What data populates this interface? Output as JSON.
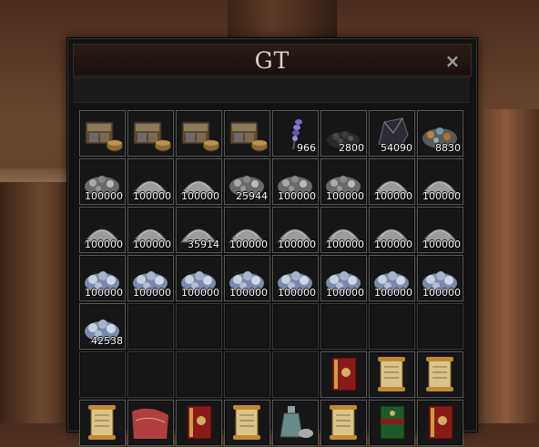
{
  "window": {
    "title": "GT",
    "close_glyph": "×"
  },
  "colors": {
    "chest": "#8a7a58",
    "ore_gray": "#9c9c9c",
    "ore_blue": "#7a8aa8",
    "scroll": "#d9c48a",
    "book_red": "#8a1a18",
    "coal": "#2a2a2a",
    "green_book": "#1f5a2a"
  },
  "inventory": [
    {
      "icon": "treasure-chest-icon",
      "qty": ""
    },
    {
      "icon": "treasure-chest-icon",
      "qty": ""
    },
    {
      "icon": "treasure-chest-icon",
      "qty": ""
    },
    {
      "icon": "treasure-chest-icon",
      "qty": ""
    },
    {
      "icon": "lavender-herb-icon",
      "qty": "966"
    },
    {
      "icon": "black-stone-pile-icon",
      "qty": "2800"
    },
    {
      "icon": "black-crystal-icon",
      "qty": "54090"
    },
    {
      "icon": "ore-mixed-pile-icon",
      "qty": "8830"
    },
    {
      "icon": "ore-pile-icon",
      "qty": "100000"
    },
    {
      "icon": "stone-pile-icon",
      "qty": "100000"
    },
    {
      "icon": "stone-pile-icon",
      "qty": "100000"
    },
    {
      "icon": "ore-pile-icon",
      "qty": "25944"
    },
    {
      "icon": "ore-pile-icon",
      "qty": "100000"
    },
    {
      "icon": "ore-pile-icon",
      "qty": "100000"
    },
    {
      "icon": "stone-pile-icon",
      "qty": "100000"
    },
    {
      "icon": "stone-pile-icon",
      "qty": "100000"
    },
    {
      "icon": "stone-pile-icon",
      "qty": "100000"
    },
    {
      "icon": "stone-pile-icon",
      "qty": "100000"
    },
    {
      "icon": "stone-pile-icon",
      "qty": "35914"
    },
    {
      "icon": "stone-pile-icon",
      "qty": "100000"
    },
    {
      "icon": "stone-pile-icon",
      "qty": "100000"
    },
    {
      "icon": "stone-pile-icon",
      "qty": "100000"
    },
    {
      "icon": "stone-pile-icon",
      "qty": "100000"
    },
    {
      "icon": "stone-pile-icon",
      "qty": "100000"
    },
    {
      "icon": "silver-ore-icon",
      "qty": "100000"
    },
    {
      "icon": "silver-ore-icon",
      "qty": "100000"
    },
    {
      "icon": "silver-ore-icon",
      "qty": "100000"
    },
    {
      "icon": "silver-ore-icon",
      "qty": "100000"
    },
    {
      "icon": "silver-ore-icon",
      "qty": "100000"
    },
    {
      "icon": "silver-ore-icon",
      "qty": "100000"
    },
    {
      "icon": "silver-ore-icon",
      "qty": "100000"
    },
    {
      "icon": "silver-ore-icon",
      "qty": "100000"
    },
    {
      "icon": "silver-ore-icon",
      "qty": "42538"
    },
    {
      "icon": "",
      "qty": ""
    },
    {
      "icon": "",
      "qty": ""
    },
    {
      "icon": "",
      "qty": ""
    },
    {
      "icon": "",
      "qty": ""
    },
    {
      "icon": "",
      "qty": ""
    },
    {
      "icon": "",
      "qty": ""
    },
    {
      "icon": "",
      "qty": ""
    },
    {
      "icon": "",
      "qty": ""
    },
    {
      "icon": "",
      "qty": ""
    },
    {
      "icon": "",
      "qty": ""
    },
    {
      "icon": "",
      "qty": ""
    },
    {
      "icon": "",
      "qty": ""
    },
    {
      "icon": "red-book-icon",
      "qty": ""
    },
    {
      "icon": "scroll-icon",
      "qty": ""
    },
    {
      "icon": "scroll-icon",
      "qty": ""
    },
    {
      "icon": "scroll-icon",
      "qty": ""
    },
    {
      "icon": "red-cloth-icon",
      "qty": ""
    },
    {
      "icon": "red-book-icon",
      "qty": ""
    },
    {
      "icon": "scroll-icon",
      "qty": ""
    },
    {
      "icon": "potion-bottle-icon",
      "qty": ""
    },
    {
      "icon": "scroll-icon",
      "qty": ""
    },
    {
      "icon": "green-book-icon",
      "qty": ""
    },
    {
      "icon": "red-book-icon",
      "qty": ""
    }
  ]
}
